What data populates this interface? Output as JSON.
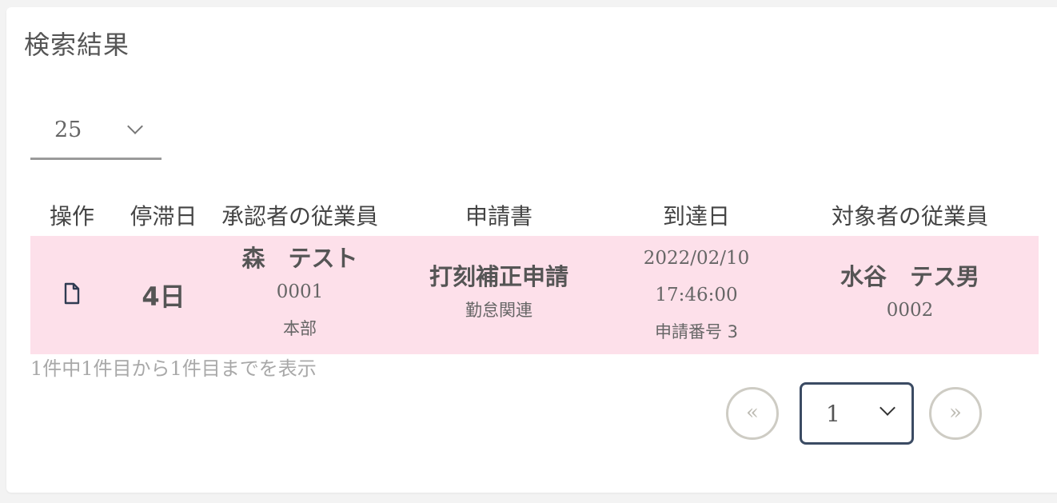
{
  "panel": {
    "title": "検索結果"
  },
  "page_size": {
    "value": "25"
  },
  "table": {
    "headers": [
      "操作",
      "停滞日",
      "承認者の従業員",
      "申請書",
      "到達日",
      "対象者の従業員"
    ],
    "rows": [
      {
        "action_icon": "document-icon",
        "stagnation_days": "4日",
        "approver": {
          "name": "森　テスト",
          "code": "0001",
          "department": "本部"
        },
        "application": {
          "name": "打刻補正申請",
          "category": "勤怠関連"
        },
        "arrival": {
          "datetime": "2022/02/10 17:46:00",
          "number": "申請番号 3"
        },
        "target": {
          "name": "水谷　テス男",
          "code": "0002"
        }
      }
    ],
    "row_highlight_color": "#fde0ea"
  },
  "summary": "1件中1件目から1件目までを表示",
  "pagination": {
    "prev_label": "«",
    "current_page": "1",
    "next_label": "»"
  }
}
